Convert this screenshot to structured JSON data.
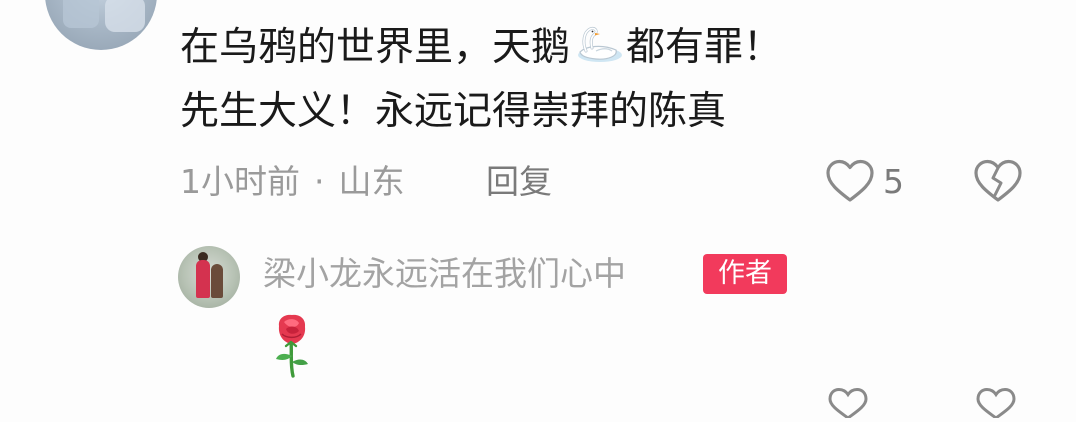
{
  "comment": {
    "line_1_prefix": "在乌鸦的世界里，天鹅",
    "line_1_suffix": "都有罪！",
    "line_2": "先生大义！永远记得崇拜的陈真",
    "time": "1小时前",
    "separator": "·",
    "location": "山东",
    "reply_label": "回复",
    "like_count": "5",
    "emoji": "swan-emoji",
    "colors": {
      "text": "#1a1a1a",
      "meta": "#9a9a9a"
    }
  },
  "reply": {
    "author_name": "梁小龙永远活在我们心中",
    "badge_label": "作者",
    "content_emoji": "rose-emoji",
    "colors": {
      "badge_bg": "#f23a5c",
      "name": "#a3a3a3"
    }
  },
  "icons": {
    "like": "heart-outline-icon",
    "dislike": "broken-heart-icon"
  }
}
